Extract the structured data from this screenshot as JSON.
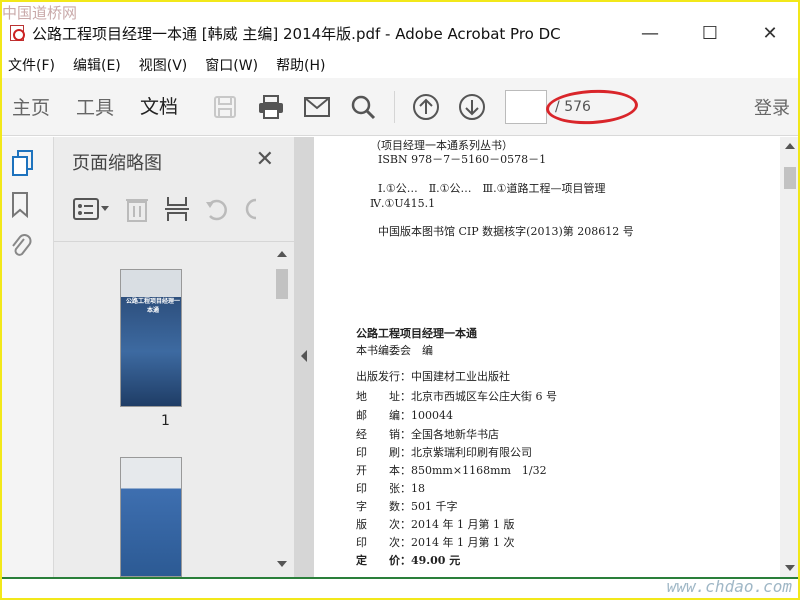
{
  "watermark": {
    "top": "中国道桥网",
    "bottom": "www.chdao.com"
  },
  "window": {
    "title": "公路工程项目经理一本通 [韩威 主编] 2014年版.pdf - Adobe Acrobat Pro DC",
    "controls": {
      "minimize": "—",
      "maximize": "☐",
      "close": "✕"
    }
  },
  "menu": {
    "items": [
      "文件(F)",
      "编辑(E)",
      "视图(V)",
      "窗口(W)",
      "帮助(H)"
    ]
  },
  "toolbar": {
    "tabs": [
      "主页",
      "工具",
      "文档"
    ],
    "active_tab": "文档",
    "page_current": "",
    "page_total": "/ 576",
    "signin": "登录"
  },
  "panel": {
    "title": "页面缩略图",
    "close": "✕",
    "thumb1_label": "1",
    "thumb1_title": "公路工程项目经理一本通"
  },
  "document": {
    "lines": [
      "（项目经理一本通系列丛书）",
      "ISBN 978－7－5160－0578－1",
      "Ⅰ.①公…　Ⅱ.①公…　Ⅲ.①道路工程—项目管理",
      "Ⅳ.①U415.1",
      "中国版本图书馆 CIP 数据核字(2013)第 208612 号",
      "公路工程项目经理一本通",
      "本书编委会　编",
      "出版发行：中国建材工业出版社",
      "地　　址：北京市西城区车公庄大街 6 号",
      "邮　　编：100044",
      "经　　销：全国各地新华书店",
      "印　　刷：北京紫瑞利印刷有限公司",
      "开　　本：850mm×1168mm　1/32",
      "印　　张：18",
      "字　　数：501 千字",
      "版　　次：2014 年 1 月第 1 版",
      "印　　次：2014 年 1 月第 1 次",
      "定　　价：49.00 元"
    ]
  },
  "colors": {
    "accent": "#1e73be",
    "highlight": "#d9252a",
    "frame": "#f2e81a"
  }
}
